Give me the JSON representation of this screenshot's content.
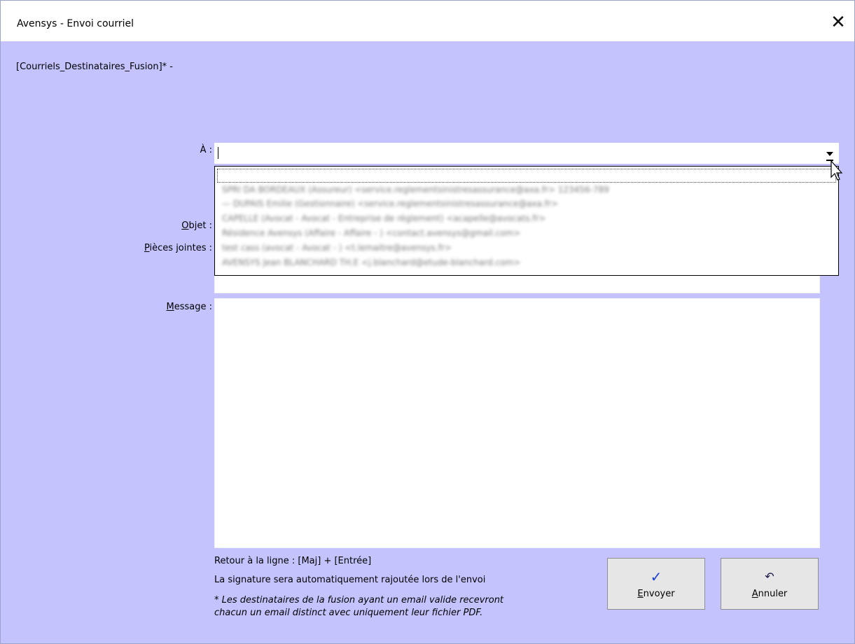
{
  "window": {
    "title": "Avensys - Envoi courriel"
  },
  "header": {
    "subtitle": "[Courriels_Destinataires_Fusion]* -"
  },
  "form": {
    "to_label_main": "À",
    "to_label_suffix": " :",
    "to_value": "",
    "subject_label_first": "O",
    "subject_label_rest": "bjet :",
    "attachments_label_first": "P",
    "attachments_label_rest": "ièces jointes :",
    "message_label_first": "M",
    "message_label_rest": "essage :"
  },
  "dropdown": {
    "items": [
      "",
      "SPRI DA BORDEAUX (Assureur) <service.reglementsinistresassurance@axa.fr> 123456-789",
      "— DUPAIS Emilie (Gestionnaire) <service.reglementsinistresassurance@axa.fr>",
      "CAPELLE (Avocat - Avocat - Entreprise de règlement) <acapelle@avocats.fr>",
      "Résidence Avensys (Affaire - Affaire - ) <contact.avensys@gmail.com>",
      "test cass (avocat - Avocat - ) <t.lemaitre@avensys.fr>",
      "AVENSYS Jean BLANCHARD TH.E <j.blanchard@etude-blanchard.com>"
    ]
  },
  "hints": {
    "line_break": "Retour à la ligne : [Maj] + [Entrée]",
    "signature": "La signature sera automatiquement rajoutée lors de l'envoi",
    "note_line1": "* Les destinataires de la fusion ayant un email valide recevront",
    "note_line2": "chacun un email distinct avec uniquement leur fichier PDF."
  },
  "buttons": {
    "send_first": "E",
    "send_rest": "nvoyer",
    "send_icon": "✓",
    "cancel_first": "A",
    "cancel_rest": "nnuler",
    "cancel_icon": "↶"
  },
  "colors": {
    "background": "#c4c3fd",
    "send_icon": "#1a3fcf"
  },
  "icons": {
    "close": "close-icon",
    "dropdown": "chevron-down-icon",
    "send": "checkmark-icon",
    "cancel": "undo-icon",
    "cursor": "mouse-pointer-icon"
  }
}
